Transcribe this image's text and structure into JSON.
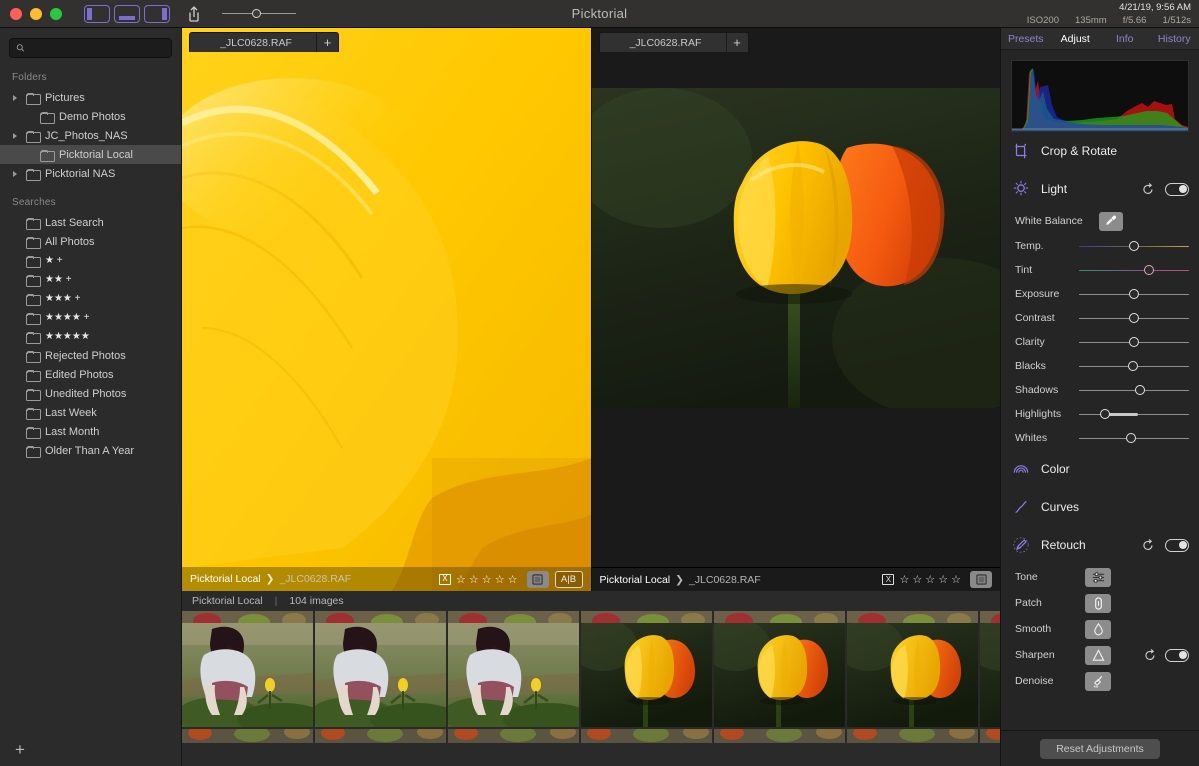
{
  "app": {
    "title": "Picktorial"
  },
  "titlebar": {
    "window_controls": [
      "close",
      "minimize",
      "maximize"
    ],
    "view_modes": [
      "view-left",
      "view-center",
      "view-right"
    ],
    "share_label": "share",
    "zoom_value": 40
  },
  "exif": {
    "datetime": "4/21/19, 9:56 AM",
    "iso": "ISO200",
    "focal": "135mm",
    "aperture": "f/5.66",
    "shutter": "1/512s"
  },
  "sidebar": {
    "search": {
      "placeholder": "",
      "value": ""
    },
    "folders_title": "Folders",
    "folders": [
      {
        "label": "Pictures",
        "indent": false,
        "disclosure": true,
        "selected": false
      },
      {
        "label": "Demo Photos",
        "indent": true,
        "disclosure": false,
        "selected": false
      },
      {
        "label": "JC_Photos_NAS",
        "indent": false,
        "disclosure": true,
        "selected": false
      },
      {
        "label": "Picktorial Local",
        "indent": true,
        "disclosure": false,
        "selected": true
      },
      {
        "label": "Picktorial NAS",
        "indent": false,
        "disclosure": true,
        "selected": false
      }
    ],
    "searches_title": "Searches",
    "searches": [
      {
        "label": "Last Search"
      },
      {
        "label": "All Photos"
      },
      {
        "label": "★ +"
      },
      {
        "label": "★★ +"
      },
      {
        "label": "★★★ +"
      },
      {
        "label": "★★★★ +"
      },
      {
        "label": "★★★★★"
      },
      {
        "label": "Rejected Photos"
      },
      {
        "label": "Edited Photos"
      },
      {
        "label": "Unedited Photos"
      },
      {
        "label": "Last Week"
      },
      {
        "label": "Last Month"
      },
      {
        "label": "Older Than A Year"
      }
    ],
    "add_label": "+"
  },
  "panes": {
    "left": {
      "tab_filename": "_JLC0628.RAF",
      "tab_add": "+",
      "crumb_folder": "Picktorial Local",
      "crumb_sep": "❯",
      "crumb_file": "_JLC0628.RAF",
      "flag": "X",
      "stars": "☆ ☆ ☆ ☆ ☆",
      "compare_label": "A|B"
    },
    "right": {
      "tab_filename": "_JLC0628.RAF",
      "tab_add": "+",
      "crumb_folder": "Picktorial Local",
      "crumb_sep": "❯",
      "crumb_file": "_JLC0628.RAF",
      "flag": "X",
      "stars": "☆ ☆ ☆ ☆ ☆"
    }
  },
  "filmstrip": {
    "folder": "Picktorial Local",
    "separator": "|",
    "count": "104 images",
    "thumbnails": [
      {
        "kind": "girl",
        "selected": false
      },
      {
        "kind": "girl",
        "selected": false
      },
      {
        "kind": "girl",
        "selected": false
      },
      {
        "kind": "tulip",
        "selected": true
      },
      {
        "kind": "tulip",
        "selected": false
      },
      {
        "kind": "tulip",
        "selected": false
      }
    ]
  },
  "rpanel": {
    "tabs": [
      {
        "label": "Presets",
        "active": false
      },
      {
        "label": "Adjust",
        "active": true
      },
      {
        "label": "Info",
        "active": false
      },
      {
        "label": "History",
        "active": false
      }
    ],
    "sections": {
      "crop": {
        "label": "Crop & Rotate",
        "icon": "crop-icon"
      },
      "light": {
        "label": "Light",
        "icon": "light-bulb-icon",
        "reset": "reset-icon",
        "toggle": "on"
      },
      "color": {
        "label": "Color",
        "icon": "color-rainbow-icon"
      },
      "curves": {
        "label": "Curves",
        "icon": "curves-icon"
      },
      "retouch": {
        "label": "Retouch",
        "icon": "brush-icon",
        "reset": "reset-icon",
        "toggle": "on"
      }
    },
    "white_balance": {
      "label": "White Balance",
      "tool": "eyedropper-icon"
    },
    "sliders": [
      {
        "label": "Temp.",
        "pos": 50,
        "kind": "temp",
        "fill": null
      },
      {
        "label": "Tint",
        "pos": 64,
        "kind": "tint",
        "fill": null
      },
      {
        "label": "Exposure",
        "pos": 50,
        "kind": "plain",
        "fill": null
      },
      {
        "label": "Contrast",
        "pos": 50,
        "kind": "plain",
        "fill": null
      },
      {
        "label": "Clarity",
        "pos": 50,
        "kind": "plain",
        "fill": null
      },
      {
        "label": "Blacks",
        "pos": 49,
        "kind": "plain",
        "fill": null
      },
      {
        "label": "Shadows",
        "pos": 55,
        "kind": "plain",
        "fill": null
      },
      {
        "label": "Highlights",
        "pos": 24,
        "kind": "plain",
        "fill": {
          "from": 24,
          "to": 54
        }
      },
      {
        "label": "Whites",
        "pos": 47,
        "kind": "plain",
        "fill": null
      }
    ],
    "retouch_tools": [
      {
        "label": "Tone",
        "icon": "tone-sliders-icon",
        "trailing": false
      },
      {
        "label": "Patch",
        "icon": "patch-link-icon",
        "trailing": false
      },
      {
        "label": "Smooth",
        "icon": "smooth-drop-icon",
        "trailing": false
      },
      {
        "label": "Sharpen",
        "icon": "sharpen-triangle-icon",
        "trailing": true
      },
      {
        "label": "Denoise",
        "icon": "denoise-broom-icon",
        "trailing": false
      }
    ],
    "reset_button": "Reset Adjustments"
  },
  "colors": {
    "accent_purple": "#7a6fd0",
    "selection_blue": "#8b7fe8",
    "yellow": "#ffc800",
    "panel_bg": "#252525",
    "sidebar_bg": "#2b2b2b"
  }
}
